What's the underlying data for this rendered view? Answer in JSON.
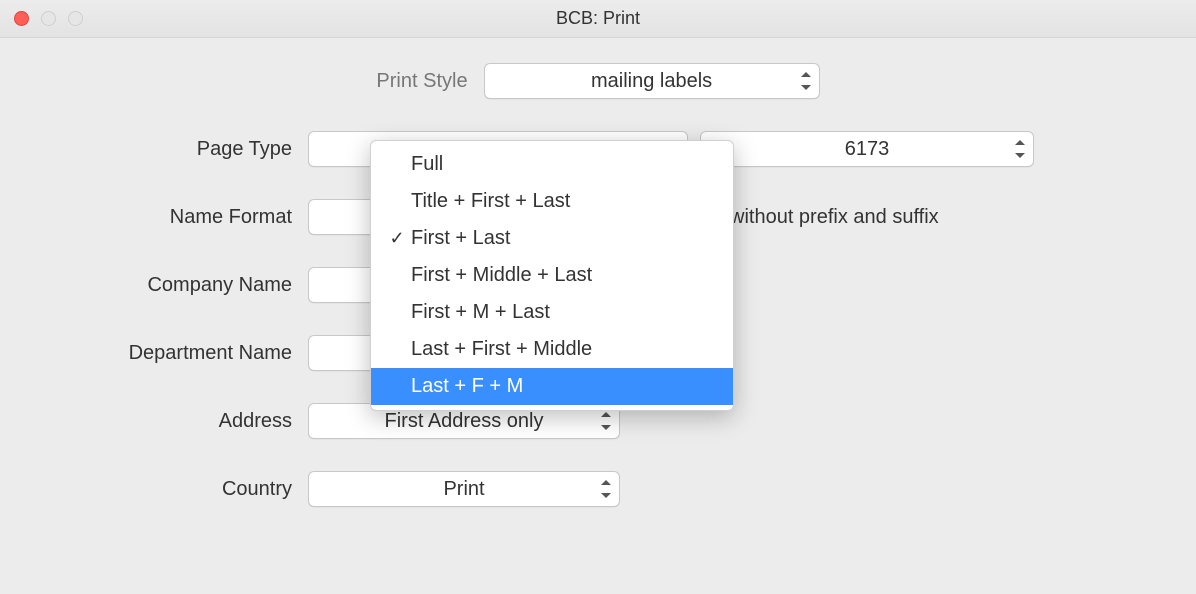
{
  "window": {
    "title": "BCB: Print"
  },
  "rows": {
    "printStyle": {
      "label": "Print Style",
      "value": "mailing labels"
    },
    "pageType": {
      "label": "Page Type",
      "value1": "",
      "value2": "6173"
    },
    "nameFormat": {
      "label": "Name Format",
      "value": "",
      "suffix": "without prefix and suffix",
      "menu": {
        "items": [
          {
            "label": "Full"
          },
          {
            "label": "Title + First + Last"
          },
          {
            "label": "First + Last",
            "checked": true
          },
          {
            "label": "First + Middle + Last"
          },
          {
            "label": "First + M + Last"
          },
          {
            "label": "Last + First + Middle"
          },
          {
            "label": "Last + F + M",
            "highlighted": true
          }
        ]
      }
    },
    "companyName": {
      "label": "Company Name",
      "value": ""
    },
    "departmentName": {
      "label": "Department Name",
      "value": ""
    },
    "address": {
      "label": "Address",
      "value": "First Address only"
    },
    "country": {
      "label": "Country",
      "value": "Print"
    }
  }
}
